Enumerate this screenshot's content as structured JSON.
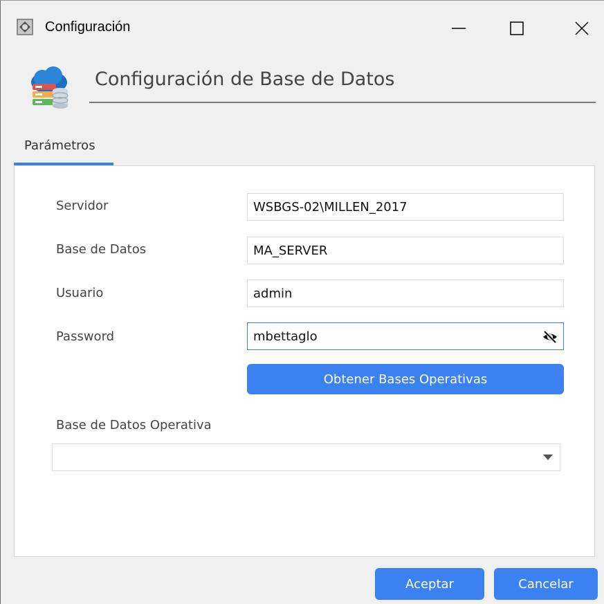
{
  "window": {
    "title": "Configuración"
  },
  "header": {
    "title": "Configuración de Base de Datos"
  },
  "tabs": [
    {
      "label": "Parámetros",
      "active": true
    }
  ],
  "form": {
    "servidor": {
      "label": "Servidor",
      "value": "WSBGS-02\\MILLEN_2017"
    },
    "base_datos": {
      "label": "Base de Datos",
      "value": "MA_SERVER"
    },
    "usuario": {
      "label": "Usuario",
      "value": "admin"
    },
    "password": {
      "label": "Password",
      "value": "mbettaglo"
    },
    "obtener_button": "Obtener Bases Operativas",
    "operativa": {
      "label": "Base de Datos Operativa",
      "value": ""
    }
  },
  "footer": {
    "aceptar": "Aceptar",
    "cancelar": "Cancelar"
  },
  "colors": {
    "accent": "#3b82f0"
  }
}
